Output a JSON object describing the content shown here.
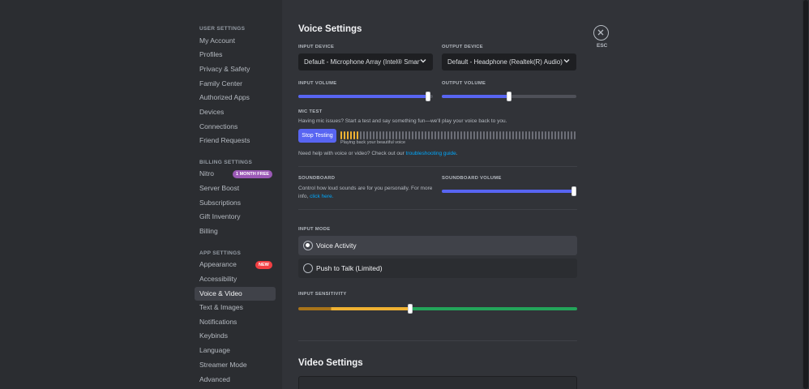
{
  "sidebar": {
    "sections": [
      {
        "heading": "User Settings",
        "items": [
          "My Account",
          "Profiles",
          "Privacy & Safety",
          "Family Center",
          "Authorized Apps",
          "Devices",
          "Connections",
          "Friend Requests"
        ]
      },
      {
        "heading": "Billing Settings",
        "items": [
          "Nitro",
          "Server Boost",
          "Subscriptions",
          "Gift Inventory",
          "Billing"
        ]
      },
      {
        "heading": "App Settings",
        "items": [
          "Appearance",
          "Accessibility",
          "Voice & Video",
          "Text & Images",
          "Notifications",
          "Keybinds",
          "Language",
          "Streamer Mode",
          "Advanced"
        ]
      }
    ],
    "nitro_badge": "1 MONTH FREE",
    "appearance_badge": "NEW",
    "active_item": "Voice & Video"
  },
  "voice": {
    "title": "Voice Settings",
    "input_device_label": "Input Device",
    "input_device_value": "Default - Microphone Array (Intel® Smart Sound Technology for Digital Microphones)",
    "output_device_label": "Output Device",
    "output_device_value": "Default - Headphone (Realtek(R) Audio)",
    "input_volume_label": "Input Volume",
    "input_volume": 0.98,
    "output_volume_label": "Output Volume",
    "output_volume": 0.5,
    "mic_test_label": "Mic Test",
    "mic_test_desc": "Having mic issues? Start a test and say something fun—we'll play your voice back to you.",
    "stop_button": "Stop Testing",
    "meter_caption": "Playing back your beautiful voice",
    "meter_active_segments": 6,
    "help_text": "Need help with voice or video? Check out our",
    "help_link": "troubleshooting guide",
    "help_end": ".",
    "soundboard_label": "Soundboard",
    "soundboard_desc": "Control how loud sounds are for you personally. For more info,",
    "soundboard_link": "click here.",
    "soundboard_volume_label": "Soundboard Volume",
    "soundboard_volume": 1.0,
    "input_mode_label": "Input Mode",
    "input_modes": [
      "Voice Activity",
      "Push to Talk (Limited)"
    ],
    "selected_mode": "Voice Activity",
    "input_sensitivity_label": "Input Sensitivity",
    "input_sensitivity": 0.4
  },
  "video": {
    "title": "Video Settings"
  },
  "close": {
    "esc_label": "ESC"
  },
  "colors": {
    "accent": "#5865f2",
    "link": "#00a8fc",
    "nitro": "#9b59b6",
    "new_badge": "#f23f43",
    "meter_active": "#f0b232",
    "sensitivity_low": "#f0b232",
    "sensitivity_high": "#23a55a"
  }
}
